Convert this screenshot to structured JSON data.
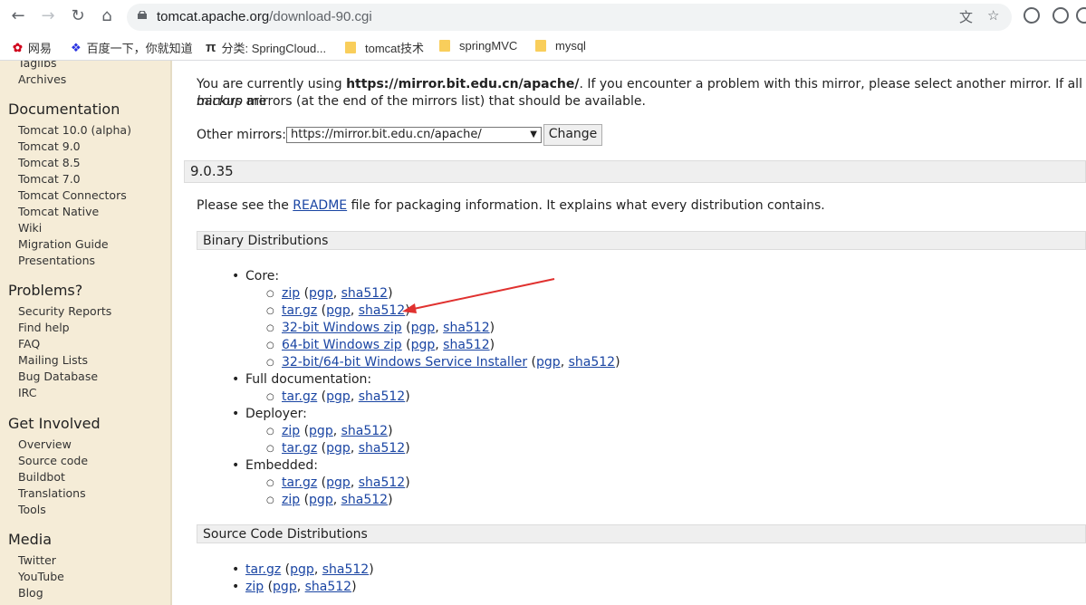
{
  "browser": {
    "url_host": "tomcat.apache.org",
    "url_path": "/download-90.cgi",
    "bookmarks": [
      {
        "label": "网易",
        "icon": "netease-icon"
      },
      {
        "label": "百度一下，你就知道",
        "icon": "baidu-paw-icon"
      },
      {
        "label": "分类: SpringCloud...",
        "icon": "pi-icon"
      },
      {
        "label": "tomcat技术",
        "icon": "folder-icon"
      },
      {
        "label": "springMVC",
        "icon": "folder-icon"
      },
      {
        "label": "mysql",
        "icon": "folder-icon"
      }
    ]
  },
  "sidebar": {
    "top_items": [
      "Taglibs",
      "Archives"
    ],
    "sections": [
      {
        "title": "Documentation",
        "items": [
          "Tomcat 10.0 (alpha)",
          "Tomcat 9.0",
          "Tomcat 8.5",
          "Tomcat 7.0",
          "Tomcat Connectors",
          "Tomcat Native",
          "Wiki",
          "Migration Guide",
          "Presentations"
        ]
      },
      {
        "title": "Problems?",
        "items": [
          "Security Reports",
          "Find help",
          "FAQ",
          "Mailing Lists",
          "Bug Database",
          "IRC"
        ]
      },
      {
        "title": "Get Involved",
        "items": [
          "Overview",
          "Source code",
          "Buildbot",
          "Translations",
          "Tools"
        ]
      },
      {
        "title": "Media",
        "items": [
          "Twitter",
          "YouTube",
          "Blog"
        ]
      }
    ]
  },
  "main": {
    "mirror_text_1": "You are currently using ",
    "mirror_url": "https://mirror.bit.edu.cn/apache/",
    "mirror_text_2": ". If you encounter a problem with this mirror, please select another mirror. If all mirrors are",
    "mirror_text_3_em": "backup",
    "mirror_text_4": " mirrors (at the end of the mirrors list) that should be available.",
    "other_mirrors_label": "Other mirrors:",
    "mirror_select_value": "https://mirror.bit.edu.cn/apache/",
    "change_button": "Change",
    "version": "9.0.35",
    "readme_pre": "Please see the ",
    "readme_link": "README",
    "readme_post": " file for packaging information. It explains what every distribution contains.",
    "binary_heading": "Binary Distributions",
    "source_heading": "Source Code Distributions",
    "core": "Core:",
    "full_doc": "Full documentation:",
    "deployer": "Deployer:",
    "embedded": "Embedded:",
    "zip": "zip",
    "targz": "tar.gz",
    "win32": "32-bit Windows zip",
    "win64": "64-bit Windows zip",
    "installer": "32-bit/64-bit Windows Service Installer",
    "pgp": "pgp",
    "sha512": "sha512"
  }
}
